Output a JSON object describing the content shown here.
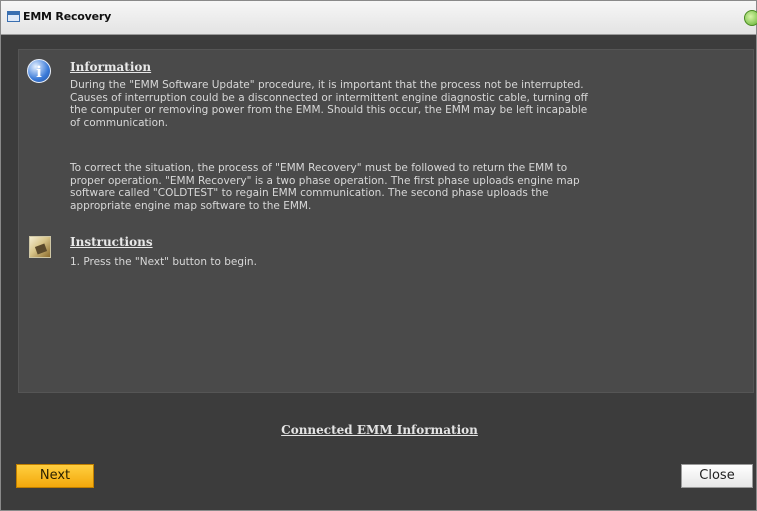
{
  "window": {
    "title": "EMM Recovery"
  },
  "information": {
    "heading": "Information",
    "paragraph1": "During the \"EMM Software Update\" procedure, it is important that the process not be interrupted.\nCauses of interruption could be a disconnected or intermittent engine diagnostic cable, turning off\nthe computer or removing power from the EMM.  Should this occur, the EMM may be left incapable\nof communication.",
    "paragraph2": "To correct the situation, the process of \"EMM Recovery\" must be followed to return the EMM to\nproper operation.  \"EMM Recovery\" is a two phase operation.  The first phase uploads engine map\nsoftware called \"COLDTEST\" to regain EMM communication.  The second phase uploads the\nappropriate engine map software to the EMM."
  },
  "instructions": {
    "heading": "Instructions",
    "step1": "1. Press the \"Next\" button to begin."
  },
  "footer": {
    "connected_link": "Connected EMM Information",
    "next_label": "Next",
    "close_label": "Close"
  },
  "colors": {
    "accent": "#f3a80b",
    "background": "#3c3c3c",
    "panel": "#4a4a4a"
  },
  "icons": {
    "info": "info-icon",
    "instructions": "instructions-icon",
    "status": "status-indicator-icon"
  }
}
